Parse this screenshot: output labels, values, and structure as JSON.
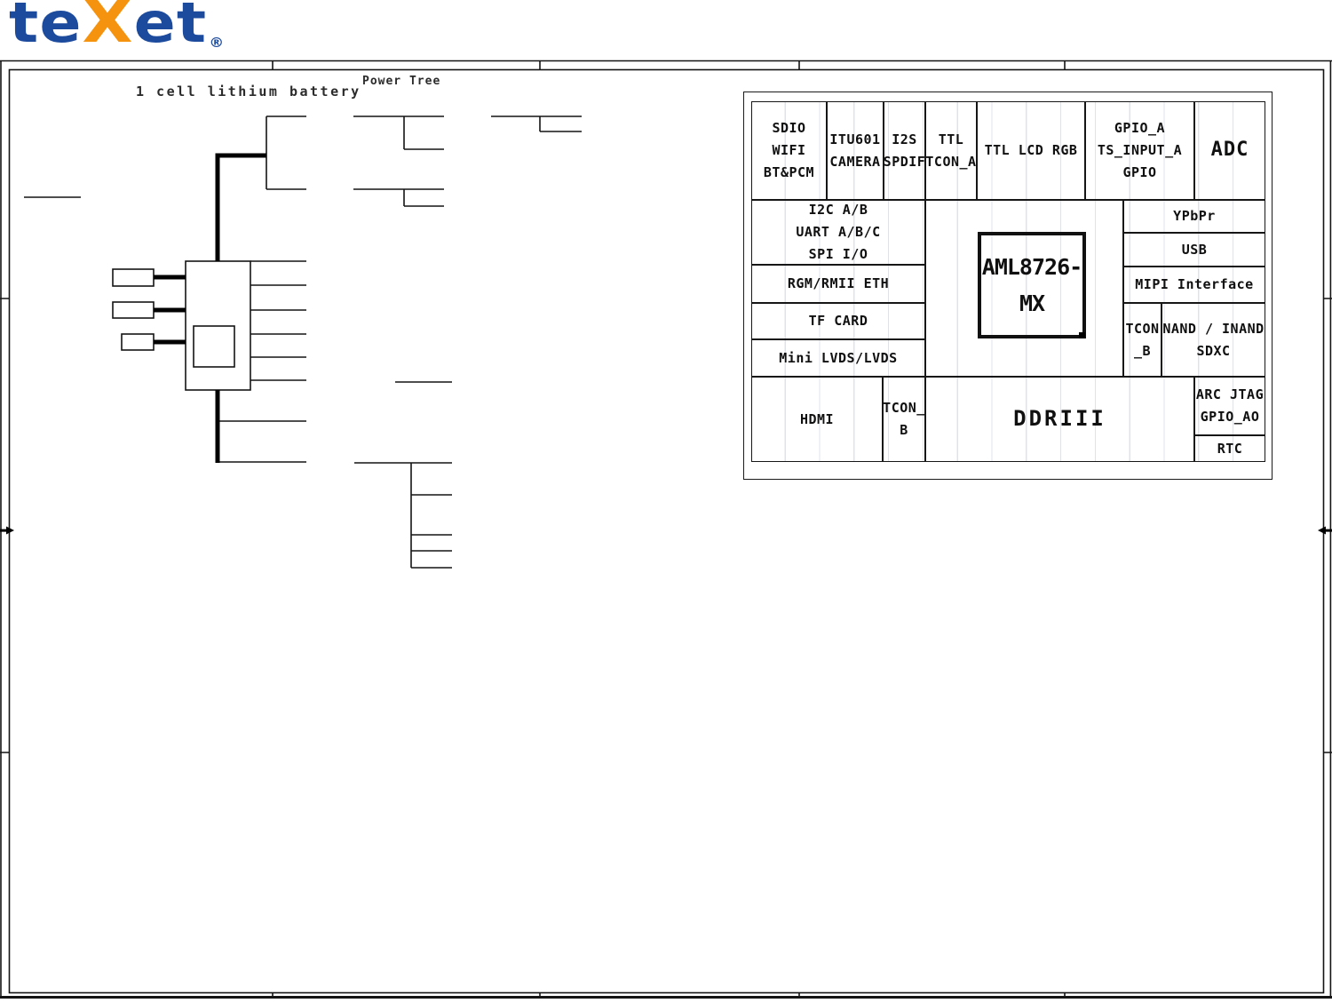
{
  "logo": {
    "pre": "te",
    "accent": "X",
    "post": "et",
    "trademark": "®"
  },
  "annotations": {
    "battery_label": "1 cell lithium battery",
    "page_title": "Power Tree"
  },
  "block_diagram": {
    "chip": "AML8726-MX",
    "cells": {
      "sdio_wifi": "SDIO WIFI\nBT&PCM",
      "itu601": "ITU601\nCAMERA",
      "i2s": "I2S\nSPDIF",
      "ttl_tcon_a": "TTL\nTCON_A",
      "ttl_lcd_rgb": "TTL LCD RGB",
      "gpio": "GPIO_A\nTS_INPUT_A\nGPIO",
      "adc": "ADC",
      "i2c_uart_spi": "I2C A/B\nUART A/B/C\nSPI I/O",
      "eth": "RGM/RMII ETH",
      "tf_card": "TF CARD",
      "lvds": "Mini LVDS/LVDS",
      "ypbpr": "YPbPr",
      "usb": "USB",
      "mipi": "MIPI Interface",
      "tcon_b_side": "TCON\n_B",
      "nand": "NAND / INAND\nSDXC",
      "hdmi": "HDMI",
      "tcon_b_bottom": "TCON_\nB",
      "ddr": "DDRIII",
      "arc_jtag": "ARC JTAG\nGPIO_AO",
      "rtc": "RTC"
    }
  },
  "colors": {
    "logo_blue": "#1c4a9d",
    "logo_orange": "#f6930e",
    "line_black": "#141414",
    "grid_gray": "#dfe3e8"
  }
}
